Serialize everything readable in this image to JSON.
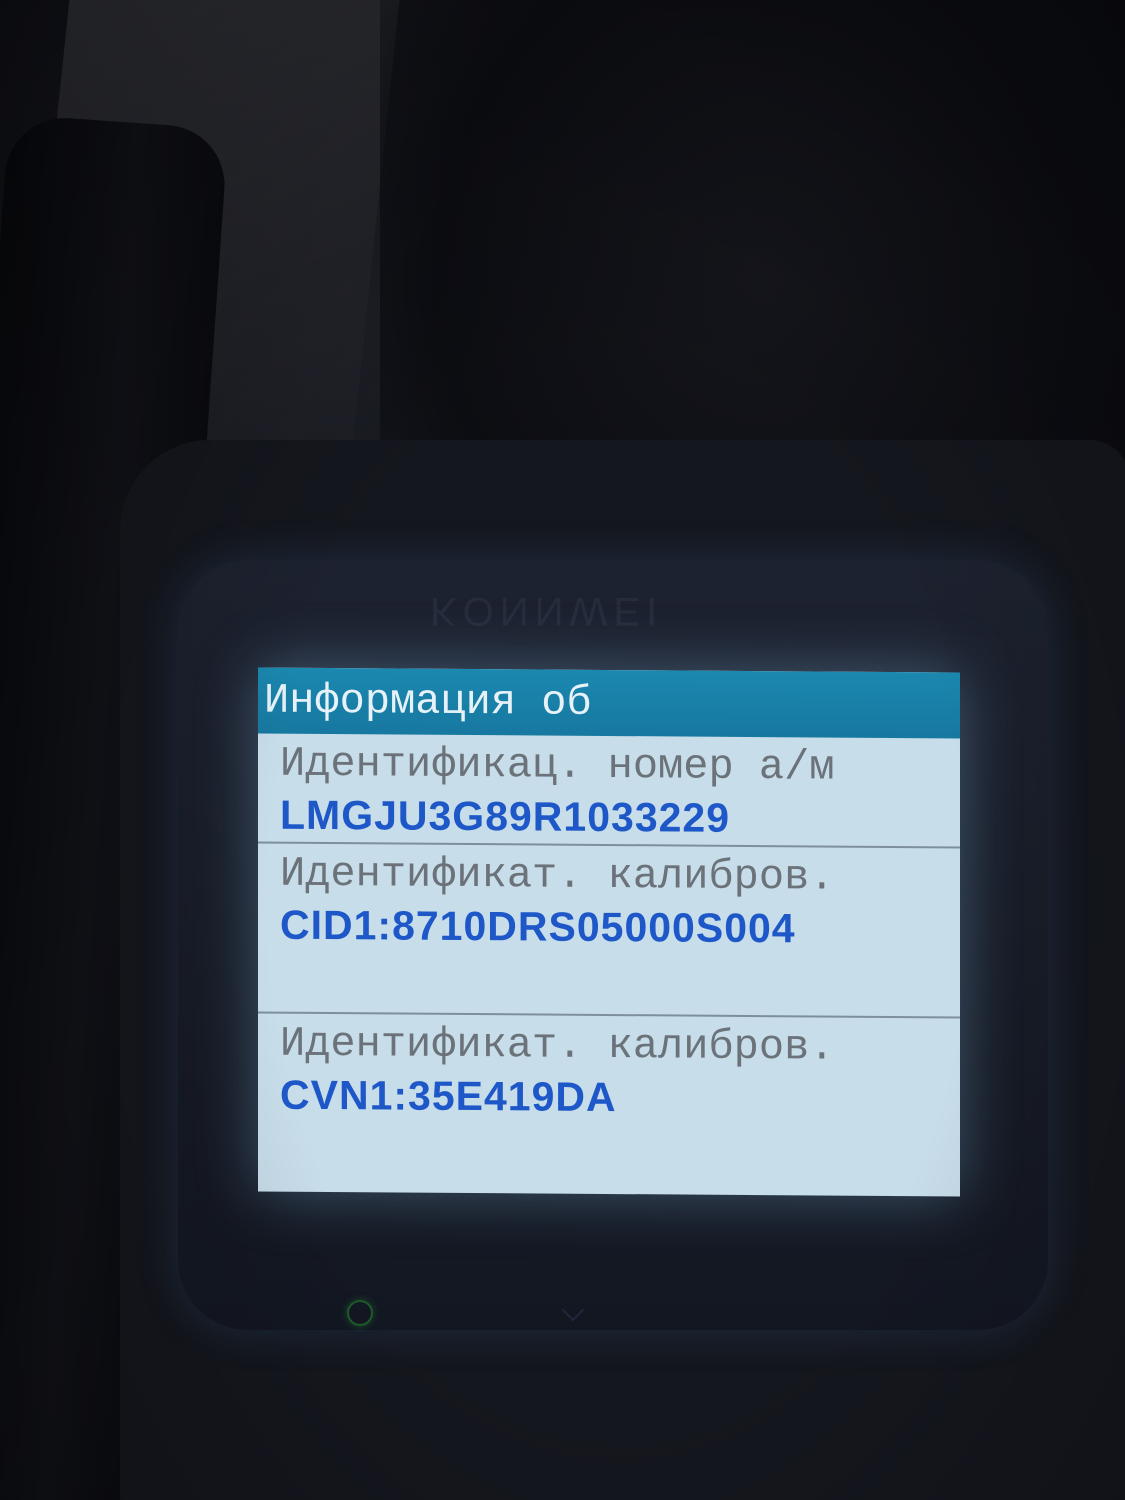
{
  "device": {
    "brand": "KONNWEI"
  },
  "screen": {
    "title": "Информация об",
    "rows": [
      {
        "label": "Идентификац. номер а/м",
        "value": "LMGJU3G89R1033229"
      },
      {
        "label": "Идентификат. калибров.",
        "value": "CID1:8710DRS05000S004"
      },
      {
        "label": "Идентификат. калибров.",
        "value": "CVN1:35E419DA"
      }
    ]
  },
  "colors": {
    "title_bar": "#1b88b0",
    "screen_bg": "#c7dde9",
    "label_text": "#6b7279",
    "value_text": "#1e58c8"
  }
}
